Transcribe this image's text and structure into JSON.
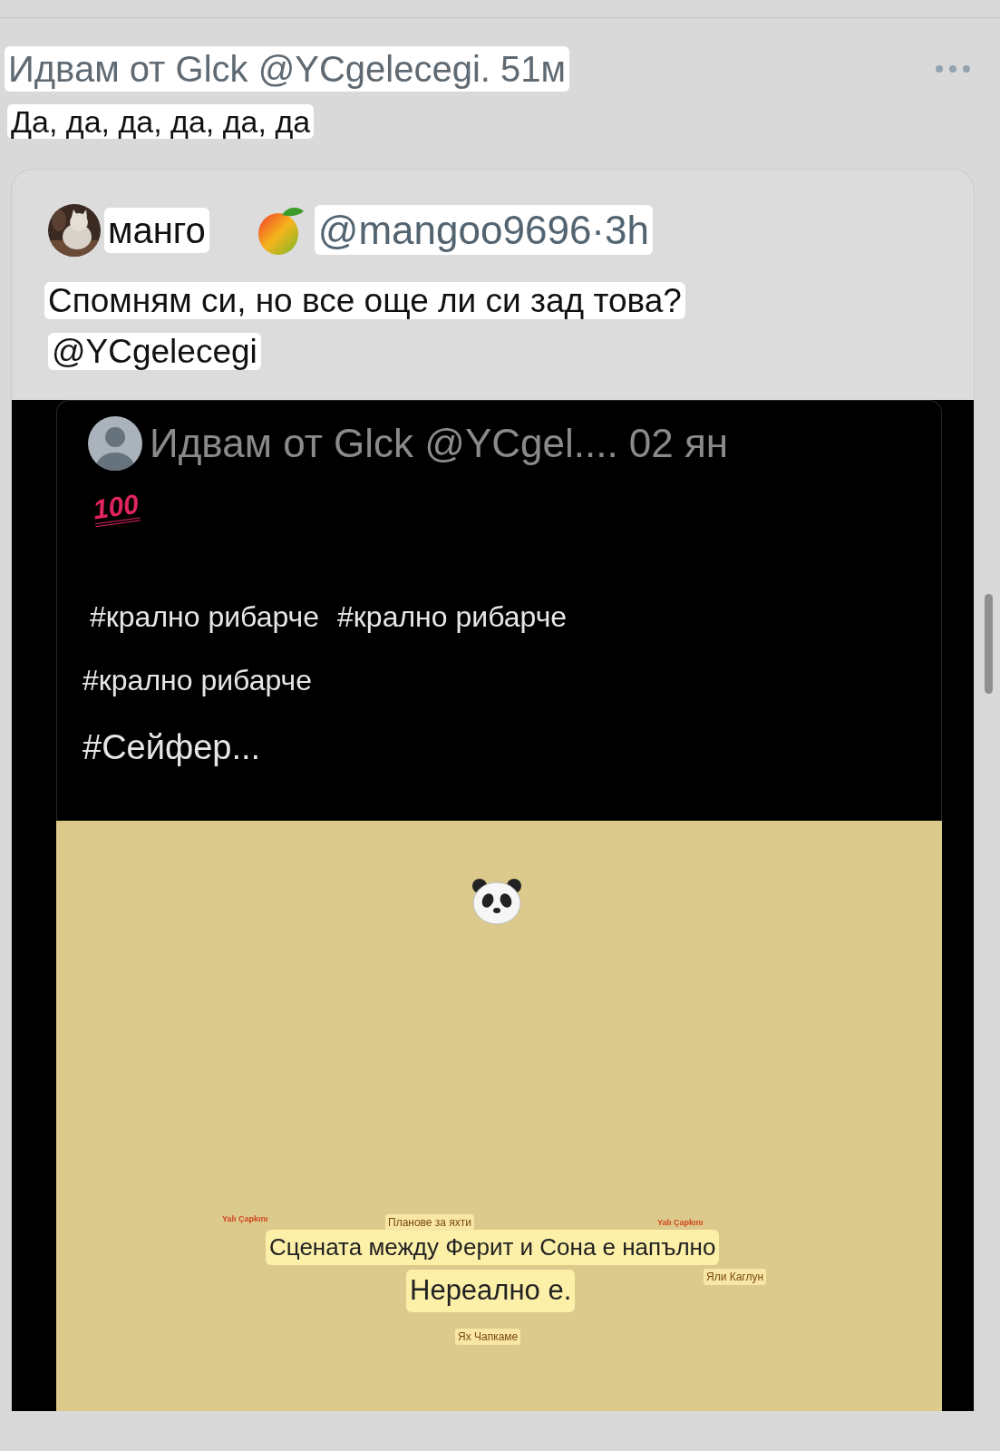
{
  "post": {
    "header": "Идвам от Glck @YCgelecegi. 51м",
    "text": "Да, да, да, да, да, да"
  },
  "quote": {
    "name": "манго",
    "handle_time": "@mangoo9696·3h",
    "text": "Спомням си, но все още ли си зад това?",
    "mention": "@YCgelecegi",
    "screenshot": {
      "header": "Идвам от Glck @YCgel.... 02 ян",
      "emoji_text": "100",
      "hashtag_lines": [
        [
          "#крално рибарче",
          "#крално рибарче"
        ],
        [
          "#крално рибарче"
        ],
        [
          "#Сейфер..."
        ]
      ],
      "captions": [
        "Сцената между Ферит и Сона е напълно",
        "Нереално е."
      ],
      "labels": [
        {
          "text": "Yalı Çapkını",
          "kind": "logo"
        },
        {
          "text": "Планове за яхти",
          "kind": "tag"
        },
        {
          "text": "Yalı Çapkını",
          "kind": "logo"
        },
        {
          "text": "Яли Каглун",
          "kind": "tag"
        },
        {
          "text": "Ях Чапкаме",
          "kind": "tag"
        }
      ]
    }
  }
}
